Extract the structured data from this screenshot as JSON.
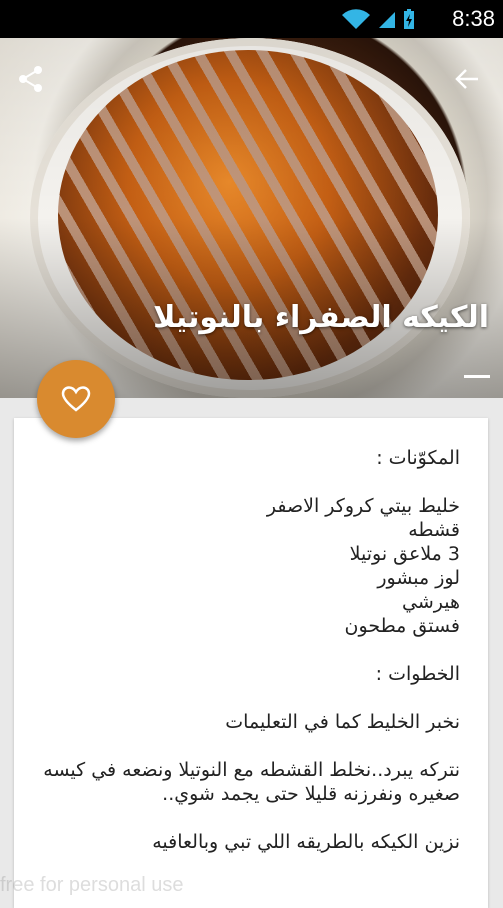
{
  "status_bar": {
    "time": "8:38"
  },
  "hero": {
    "title": "الكيكه الصفراء بالنوتيلا"
  },
  "recipe": {
    "ingredients_heading": "المكوّنات :",
    "ingredients": [
      "خليط بيتي كروكر الاصفر",
      "قشطه",
      "3 ملاعق نوتيلا",
      "لوز مبشور",
      "هيرشي",
      "فستق مطحون"
    ],
    "steps_heading": "الخطوات :",
    "steps": [
      "نخبر الخليط كما في التعليمات",
      "نتركه يبرد..نخلط القشطه مع النوتيلا ونضعه في كيسه صغيره ونفرزنه قليلا حتى يجمد شوي..",
      "نزين الكيكه بالطريقه اللي تبي وبالعافيه"
    ]
  },
  "watermark": "free for personal use",
  "colors": {
    "accent": "#d98a2f",
    "status_bar": "#000000",
    "status_icons": "#33b5e5"
  },
  "icons": {
    "back": "arrow-left-icon",
    "share": "share-icon",
    "favorite": "heart-outline-icon"
  }
}
